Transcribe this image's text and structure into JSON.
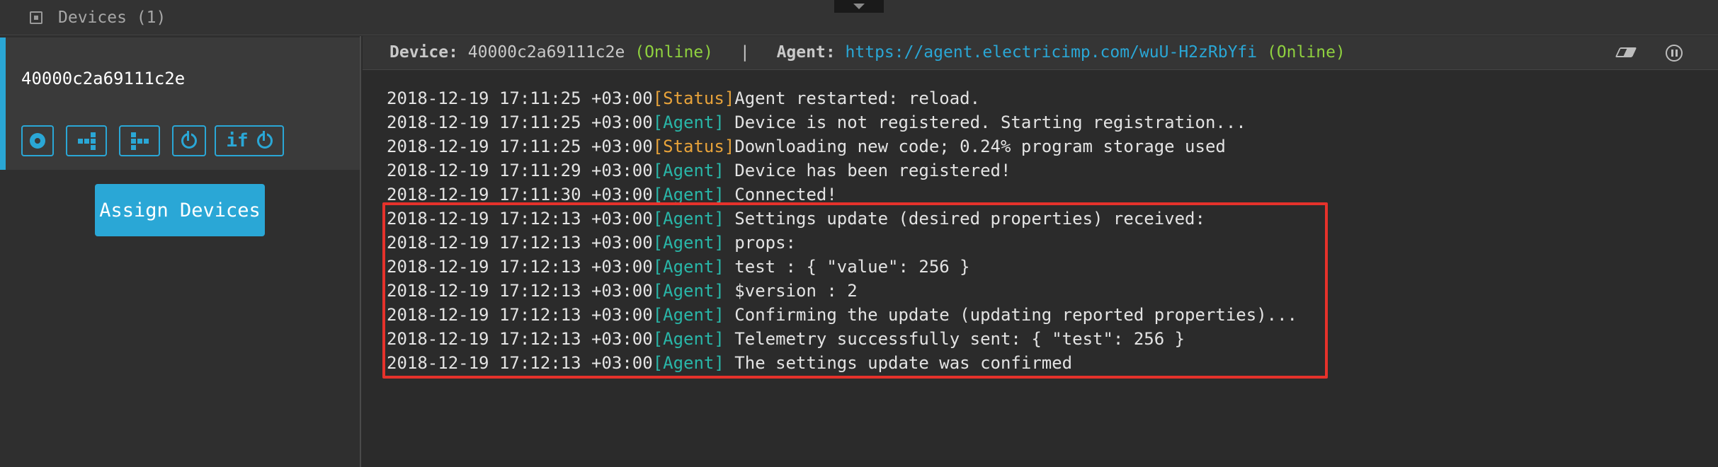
{
  "topbar": {
    "title": "Devices (1)"
  },
  "device": {
    "id": "40000c2a69111c2e",
    "buttons": {
      "ifpower_label": "if"
    }
  },
  "assign_button": "Assign Devices",
  "log_header": {
    "device_label": "Device:",
    "device_id": "40000c2a69111c2e",
    "device_status": "(Online)",
    "separator": "|",
    "agent_label": "Agent:",
    "agent_url": "https://agent.electricimp.com/wuU-H2zRbYfi",
    "agent_status": "(Online)"
  },
  "log": [
    {
      "ts": "2018-12-19 17:11:25 +03:00",
      "tag": "[Status]",
      "kind": "status",
      "msg": "Agent restarted: reload."
    },
    {
      "ts": "2018-12-19 17:11:25 +03:00",
      "tag": "[Agent]",
      "kind": "agent",
      "msg": " Device is not registered. Starting registration..."
    },
    {
      "ts": "2018-12-19 17:11:25 +03:00",
      "tag": "[Status]",
      "kind": "status",
      "msg": "Downloading new code; 0.24% program storage used"
    },
    {
      "ts": "2018-12-19 17:11:29 +03:00",
      "tag": "[Agent]",
      "kind": "agent",
      "msg": " Device has been registered!"
    },
    {
      "ts": "2018-12-19 17:11:30 +03:00",
      "tag": "[Agent]",
      "kind": "agent",
      "msg": " Connected!"
    },
    {
      "ts": "2018-12-19 17:12:13 +03:00",
      "tag": "[Agent]",
      "kind": "agent",
      "msg": " Settings update (desired properties) received:"
    },
    {
      "ts": "2018-12-19 17:12:13 +03:00",
      "tag": "[Agent]",
      "kind": "agent",
      "msg": " props:"
    },
    {
      "ts": "2018-12-19 17:12:13 +03:00",
      "tag": "[Agent]",
      "kind": "agent",
      "msg": " test : { \"value\": 256 }"
    },
    {
      "ts": "2018-12-19 17:12:13 +03:00",
      "tag": "[Agent]",
      "kind": "agent",
      "msg": " $version : 2"
    },
    {
      "ts": "2018-12-19 17:12:13 +03:00",
      "tag": "[Agent]",
      "kind": "agent",
      "msg": " Confirming the update (updating reported properties)..."
    },
    {
      "ts": "2018-12-19 17:12:13 +03:00",
      "tag": "[Agent]",
      "kind": "agent",
      "msg": " Telemetry successfully sent: { \"test\": 256 }"
    },
    {
      "ts": "2018-12-19 17:12:13 +03:00",
      "tag": "[Agent]",
      "kind": "agent",
      "msg": " The settings update was confirmed"
    }
  ],
  "colors": {
    "accent": "#2aa7d6",
    "online": "#8fd13f",
    "agent_tag": "#29b6a8",
    "status_tag": "#e8a33a",
    "highlight": "#e5322b"
  },
  "icons": [
    "chip-icon",
    "gear-icon",
    "tree-left-icon",
    "tree-right-icon",
    "power-icon",
    "eraser-icon",
    "pause-icon"
  ]
}
